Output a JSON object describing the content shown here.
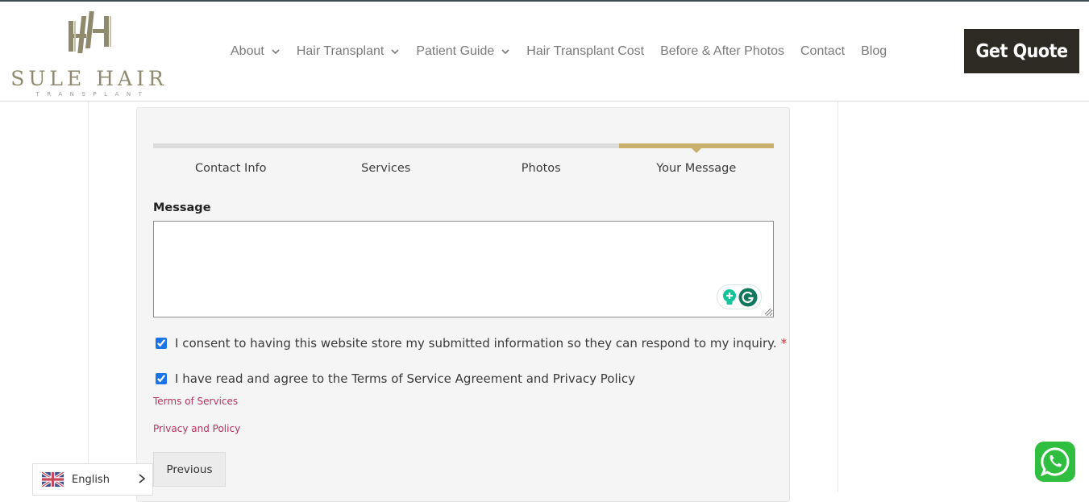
{
  "brand": {
    "name": "SULE HAIR",
    "tagline": "TRANSPLANT",
    "accent_color": "#c9b06c",
    "logo_color": "#8f8a6d"
  },
  "nav": {
    "items": [
      {
        "label": "About",
        "has_dropdown": true
      },
      {
        "label": "Hair Transplant",
        "has_dropdown": true
      },
      {
        "label": "Patient Guide",
        "has_dropdown": true
      },
      {
        "label": "Hair Transplant Cost",
        "has_dropdown": false
      },
      {
        "label": "Before & After Photos",
        "has_dropdown": false
      },
      {
        "label": "Contact",
        "has_dropdown": false
      },
      {
        "label": "Blog",
        "has_dropdown": false
      }
    ],
    "cta_label": "Get Quote"
  },
  "form": {
    "steps": [
      {
        "label": "Contact Info",
        "active": false
      },
      {
        "label": "Services",
        "active": false
      },
      {
        "label": "Photos",
        "active": false
      },
      {
        "label": "Your Message",
        "active": true
      }
    ],
    "current_step": 4,
    "total_steps": 4,
    "message_label": "Message",
    "message_value": "",
    "consent_label": "I consent to having this website store my submitted information so they can respond to my inquiry.",
    "consent_required_mark": "*",
    "consent_checked": true,
    "terms_label": "I have read and agree to the Terms of Service Agreement and Privacy Policy",
    "terms_checked": true,
    "terms_link": "Terms of Services",
    "privacy_link": "Privacy and Policy",
    "previous_label": "Previous"
  },
  "language": {
    "selected": "English",
    "flag": "uk-flag-icon"
  },
  "widgets": {
    "grammarly_icons": [
      "grammarly-suggestion-icon",
      "grammarly-g-icon"
    ],
    "whatsapp": "whatsapp-icon"
  }
}
